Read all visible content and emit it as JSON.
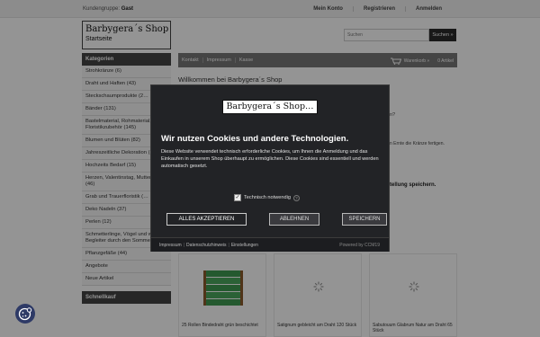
{
  "topbar": {
    "customer_group_label": "Kundengruppe:",
    "customer_group_value": "Gast",
    "nav": [
      "Mein Konto",
      "Registrieren",
      "Anmelden"
    ]
  },
  "logo": {
    "brand": "Barbygera´s Shop",
    "subtitle": "Startseite"
  },
  "search": {
    "placeholder": "Suchen",
    "button": "Suchen »"
  },
  "sidebar": {
    "heading": "Kategorien",
    "items": [
      "Strohkränze (6)",
      "Draht und Haften (43)",
      "Steckschaumprodukte (2…",
      "Bänder (131)",
      "Bastelmaterial, Rohmaterial, Floristikzubehör (145)",
      "Blumen und Blüten (82)",
      "Jahreszeitliche Dekoration (179)",
      "Hochzeits Bedarf (15)",
      "Herzen, Valentinstag, Muttertag (46)",
      "Grab und Trauerfloristik (…",
      "Deko Nadeln (37)",
      "Perlen (12)",
      "Schmetterlinge, Vögel und weitere Begleiter durch den Sommer (71)",
      "Pflanzgefäße (44)",
      "Angebote",
      "Neue Artikel"
    ],
    "quick_buy": "Schnellkauf"
  },
  "mainbar": {
    "links": [
      "Kontakt",
      "Impressum",
      "Kasse"
    ],
    "cart_label": "Warenkorb »",
    "cart_count": "0 Artikel"
  },
  "welcome": "Willkommen bei Barbygera´s Shop",
  "modal": {
    "logo_text": "Barbygera´s Shop…",
    "title": "Wir nutzen Cookies und andere Technologien.",
    "text": "Diese Website verwendet technisch erforderliche Cookies, um Ihnen die Anmeldung und das Einkaufen in unserem Shop überhaupt zu ermöglichen. Diese Cookies sind essentiell und werden automatisch gesetzt.",
    "checkbox_label": "Technisch notwendig",
    "accept": "ALLES AKZEPTIEREN",
    "decline": "ABLEHNEN",
    "save": "SPEICHERN",
    "footer_links": [
      "Impressum",
      "Datenschutzhinweis",
      "Einstellungen"
    ],
    "powered_by": "Powered by CCM19"
  },
  "background_snippets": {
    "q": "n?",
    "kraenze": "n Ernte die Kränze fertigen.",
    "speichern": "tellung speichern."
  },
  "products": [
    {
      "title": "25 Rollen Bindedraht grün beschichtet"
    },
    {
      "title": "Satignum gebleicht am Draht 120 Stück"
    },
    {
      "title": "Sabutouum Glabrum Natur am Draht 65 Stück"
    }
  ],
  "colors": {
    "modal_bg": "#222326",
    "sidebar_head": "#444444",
    "mainbar": "#777777",
    "cookie_fab": "#2e3a66"
  }
}
